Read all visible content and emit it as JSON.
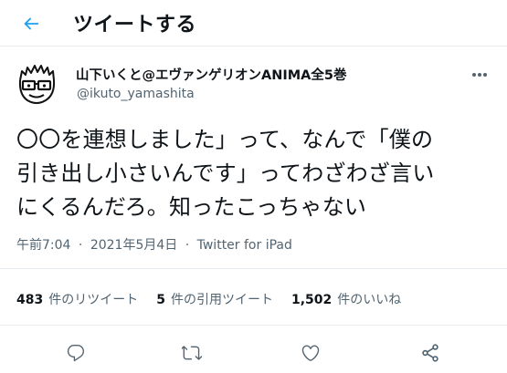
{
  "header": {
    "title": "ツイートする"
  },
  "author": {
    "display_name": "山下いくと@エヴァンゲリオンANIMA全5巻",
    "username": "@ikuto_yamashita"
  },
  "tweet": {
    "text": "〇〇を連想しました」って、なんで「僕の\n引き出し小さいんです」ってわざわざ言い\nにくるんだろ。知ったこっちゃない"
  },
  "meta": {
    "time": "午前7:04",
    "separator": "·",
    "date": "2021年5月4日",
    "client": "Twitter for iPad"
  },
  "stats": {
    "retweets_count": "483",
    "retweets_label": "件のリツイート",
    "quotes_count": "5",
    "quotes_label": "件の引用ツイート",
    "likes_count": "1,502",
    "likes_label": "件のいいね"
  },
  "icons": {
    "back": "arrow-left-icon",
    "more": "more-vertical-icon",
    "reply": "reply-icon",
    "retweet": "retweet-icon",
    "like": "heart-icon",
    "share": "share-icon"
  },
  "colors": {
    "accent": "#1da1f2",
    "text": "#0f1419",
    "secondary": "#536471",
    "divider": "#e6ecf0"
  }
}
